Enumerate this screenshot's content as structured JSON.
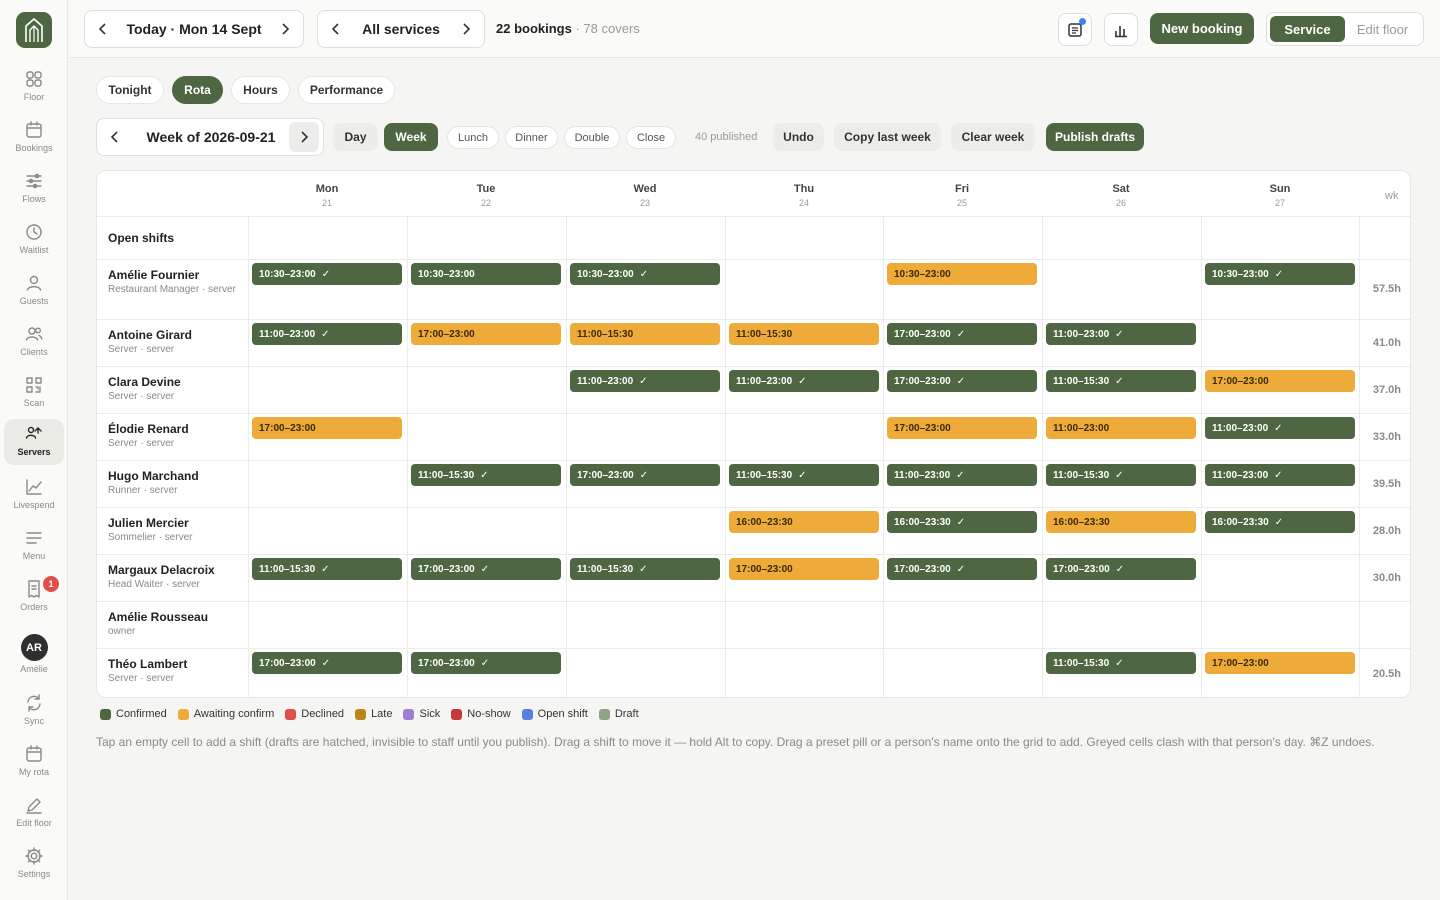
{
  "sidebar": {
    "items": [
      {
        "label": "Floor",
        "icon": "grid-icon"
      },
      {
        "label": "Bookings",
        "icon": "calendar-icon"
      },
      {
        "label": "Flows",
        "icon": "sliders-icon"
      },
      {
        "label": "Waitlist",
        "icon": "clock-icon"
      },
      {
        "label": "Guests",
        "icon": "user-icon"
      },
      {
        "label": "Clients",
        "icon": "users-icon"
      },
      {
        "label": "Scan",
        "icon": "qr-icon"
      },
      {
        "label": "Servers",
        "icon": "servers-icon"
      },
      {
        "label": "Livespend",
        "icon": "trend-icon"
      },
      {
        "label": "Menu",
        "icon": "menu-icon"
      },
      {
        "label": "Orders",
        "icon": "receipt-icon",
        "badge": "1"
      },
      {
        "label": "Amélie",
        "avatar": "AR"
      },
      {
        "label": "Sync",
        "icon": "sync-icon"
      },
      {
        "label": "My rota",
        "icon": "calendar-icon"
      },
      {
        "label": "Edit floor",
        "icon": "pencil-icon"
      },
      {
        "label": "Settings",
        "icon": "gear-icon"
      }
    ]
  },
  "header": {
    "date_label": "Today · Mon 14 Sept",
    "services_label": "All services",
    "bookings_count": "22 bookings",
    "covers": " · 78 covers",
    "new_booking": "New booking",
    "mode_service": "Service",
    "mode_edit": "Edit floor"
  },
  "tabs": [
    "Tonight",
    "Rota",
    "Hours",
    "Performance"
  ],
  "toolbar": {
    "week_label": "Week of 2026-09-21",
    "day": "Day",
    "week": "Week",
    "presets": [
      "Lunch",
      "Dinner",
      "Double",
      "Close"
    ],
    "published": "40 published",
    "undo": "Undo",
    "copy_last_week": "Copy last week",
    "clear_week": "Clear week",
    "publish_drafts": "Publish drafts"
  },
  "grid": {
    "days": [
      {
        "name": "Mon",
        "num": "21"
      },
      {
        "name": "Tue",
        "num": "22"
      },
      {
        "name": "Wed",
        "num": "23"
      },
      {
        "name": "Thu",
        "num": "24"
      },
      {
        "name": "Fri",
        "num": "25"
      },
      {
        "name": "Sat",
        "num": "26"
      },
      {
        "name": "Sun",
        "num": "27"
      }
    ],
    "wk_label": "wk",
    "open_shifts_label": "Open shifts",
    "rows": [
      {
        "name": "Amélie Fournier",
        "role": "Restaurant Manager · server",
        "total": "57.5h",
        "shifts": [
          {
            "day": 0,
            "time": "10:30–23:00",
            "status": "confirmed"
          },
          {
            "day": 1,
            "time": "10:30–23:00",
            "status": "confirmed",
            "no_tick": true
          },
          {
            "day": 2,
            "time": "10:30–23:00",
            "status": "confirmed"
          },
          {
            "day": 4,
            "time": "10:30–23:00",
            "status": "awaiting"
          },
          {
            "day": 6,
            "time": "10:30–23:00",
            "status": "confirmed"
          }
        ]
      },
      {
        "name": "Antoine Girard",
        "role": "Server · server",
        "total": "41.0h",
        "shifts": [
          {
            "day": 0,
            "time": "11:00–23:00",
            "status": "confirmed"
          },
          {
            "day": 1,
            "time": "17:00–23:00",
            "status": "awaiting"
          },
          {
            "day": 2,
            "time": "11:00–15:30",
            "status": "awaiting"
          },
          {
            "day": 3,
            "time": "11:00–15:30",
            "status": "awaiting"
          },
          {
            "day": 4,
            "time": "17:00–23:00",
            "status": "confirmed"
          },
          {
            "day": 5,
            "time": "11:00–23:00",
            "status": "confirmed"
          }
        ]
      },
      {
        "name": "Clara Devine",
        "role": "Server · server",
        "total": "37.0h",
        "shifts": [
          {
            "day": 2,
            "time": "11:00–23:00",
            "status": "confirmed"
          },
          {
            "day": 3,
            "time": "11:00–23:00",
            "status": "confirmed"
          },
          {
            "day": 4,
            "time": "17:00–23:00",
            "status": "confirmed"
          },
          {
            "day": 5,
            "time": "11:00–15:30",
            "status": "confirmed"
          },
          {
            "day": 6,
            "time": "17:00–23:00",
            "status": "awaiting"
          }
        ]
      },
      {
        "name": "Élodie Renard",
        "role": "Server · server",
        "total": "33.0h",
        "shifts": [
          {
            "day": 0,
            "time": "17:00–23:00",
            "status": "awaiting"
          },
          {
            "day": 4,
            "time": "17:00–23:00",
            "status": "awaiting"
          },
          {
            "day": 5,
            "time": "11:00–23:00",
            "status": "awaiting"
          },
          {
            "day": 6,
            "time": "11:00–23:00",
            "status": "confirmed"
          }
        ]
      },
      {
        "name": "Hugo Marchand",
        "role": "Runner · server",
        "total": "39.5h",
        "shifts": [
          {
            "day": 1,
            "time": "11:00–15:30",
            "status": "confirmed"
          },
          {
            "day": 2,
            "time": "17:00–23:00",
            "status": "confirmed"
          },
          {
            "day": 3,
            "time": "11:00–15:30",
            "status": "confirmed"
          },
          {
            "day": 4,
            "time": "11:00–23:00",
            "status": "confirmed"
          },
          {
            "day": 5,
            "time": "11:00–15:30",
            "status": "confirmed"
          },
          {
            "day": 6,
            "time": "11:00–23:00",
            "status": "confirmed"
          }
        ]
      },
      {
        "name": "Julien Mercier",
        "role": "Sommelier · server",
        "total": "28.0h",
        "shifts": [
          {
            "day": 3,
            "time": "16:00–23:30",
            "status": "awaiting"
          },
          {
            "day": 4,
            "time": "16:00–23:30",
            "status": "confirmed"
          },
          {
            "day": 5,
            "time": "16:00–23:30",
            "status": "awaiting"
          },
          {
            "day": 6,
            "time": "16:00–23:30",
            "status": "confirmed"
          }
        ]
      },
      {
        "name": "Margaux Delacroix",
        "role": "Head Waiter · server",
        "total": "30.0h",
        "shifts": [
          {
            "day": 0,
            "time": "11:00–15:30",
            "status": "confirmed"
          },
          {
            "day": 1,
            "time": "17:00–23:00",
            "status": "confirmed"
          },
          {
            "day": 2,
            "time": "11:00–15:30",
            "status": "confirmed"
          },
          {
            "day": 3,
            "time": "17:00–23:00",
            "status": "awaiting"
          },
          {
            "day": 4,
            "time": "17:00–23:00",
            "status": "confirmed"
          },
          {
            "day": 5,
            "time": "17:00–23:00",
            "status": "confirmed"
          }
        ]
      },
      {
        "name": "Amélie Rousseau",
        "role": "owner",
        "total": "",
        "shifts": []
      },
      {
        "name": "Théo Lambert",
        "role": "Server · server",
        "total": "20.5h",
        "shifts": [
          {
            "day": 0,
            "time": "17:00–23:00",
            "status": "confirmed"
          },
          {
            "day": 1,
            "time": "17:00–23:00",
            "status": "confirmed"
          },
          {
            "day": 5,
            "time": "11:00–15:30",
            "status": "confirmed"
          },
          {
            "day": 6,
            "time": "17:00–23:00",
            "status": "awaiting"
          }
        ]
      }
    ]
  },
  "legend": [
    {
      "label": "Confirmed",
      "color": "#4e6641"
    },
    {
      "label": "Awaiting confirm",
      "color": "#eeab39"
    },
    {
      "label": "Declined",
      "color": "#e0504a"
    },
    {
      "label": "Late",
      "color": "#b8861b"
    },
    {
      "label": "Sick",
      "color": "#9b7fd4"
    },
    {
      "label": "No-show",
      "color": "#c83a3a"
    },
    {
      "label": "Open shift",
      "color": "#5b7fe0"
    },
    {
      "label": "Draft",
      "color": "#8fa387"
    }
  ],
  "hint": "Tap an empty cell to add a shift (drafts are hatched, invisible to staff until you publish). Drag a shift to move it — hold Alt to copy. Drag a preset pill or a person's name onto the grid to add. Greyed cells clash with that person's day. ⌘Z undoes.",
  "tick_glyph": "✓"
}
